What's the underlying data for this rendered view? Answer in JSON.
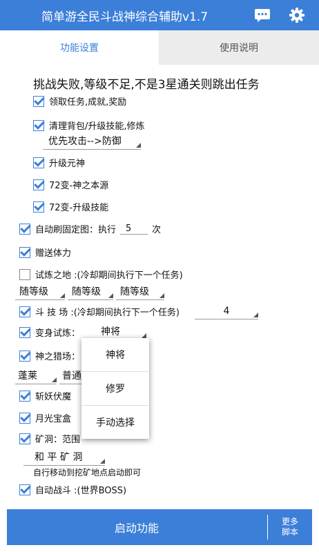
{
  "app": {
    "title": "简单游全民斗战神综合辅助v1.7"
  },
  "tabs": [
    {
      "label": "功能设置"
    },
    {
      "label": "使用说明"
    }
  ],
  "headline": "挑战失败,等级不足,不是3星通关则跳出任务",
  "options": {
    "receive_tasks": {
      "label": "领取任务,成就,奖励",
      "checked": true
    },
    "clean_bag": {
      "label": "清理背包/升级技能,修炼",
      "checked": true
    },
    "priority": {
      "value": "优先攻击-->防御"
    },
    "upgrade_spirit": {
      "label": "升级元神",
      "checked": true
    },
    "source_72": {
      "label": "72变-神之本源",
      "checked": true
    },
    "skill_72": {
      "label": "72变-升级技能",
      "checked": true
    },
    "auto_map": {
      "label_a": "自动刷固定图：执行",
      "count": "5",
      "label_b": "次",
      "checked": true
    },
    "gift_stamina": {
      "label": "赠送体力",
      "checked": true
    },
    "trial_land": {
      "label": "试炼之地 :(冷却期间执行下一个任务)",
      "checked": false
    },
    "level_selects": [
      "随等级",
      "随等级",
      "随等级"
    ],
    "arena": {
      "label": "斗 技 场 :(冷却期间执行下一个任务)",
      "value": "4",
      "checked": true
    },
    "transform_trial": {
      "label": "变身试炼：",
      "value": "神将",
      "checked": true
    },
    "hunt_field": {
      "label": "神之猎场：",
      "checked": true
    },
    "hunt_selects": [
      "蓬莱",
      "普通"
    ],
    "slay_demons": {
      "label": "斩妖伏魔",
      "checked": true
    },
    "moonlight_box": {
      "label": "月光宝盒",
      "checked": true
    },
    "mine_cave": {
      "label": "矿洞：范围",
      "checked": true
    },
    "mine_select": "和 平 矿 洞",
    "mine_hint": "自行移动到挖矿地点启动即可",
    "auto_battle": {
      "label": "自动战斗 :(世界BOSS)",
      "checked": true
    }
  },
  "dropdown_popup": {
    "options": [
      "神将",
      "修罗",
      "手动选择"
    ]
  },
  "bottom": {
    "start_label": "启动功能",
    "more_line1": "更多",
    "more_line2": "脚本"
  },
  "icons": {
    "chat": "chat-bubble-icon",
    "settings": "gear-icon"
  },
  "colors": {
    "primary": "#3c7fd8",
    "inactive_tab": "#ececec"
  }
}
